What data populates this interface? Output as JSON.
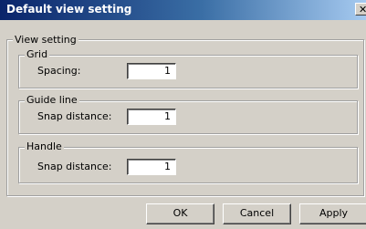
{
  "window": {
    "title": "Default view setting",
    "close_glyph": "✕"
  },
  "view_setting": {
    "label": "View setting",
    "grid": {
      "label": "Grid",
      "field_label": "Spacing:",
      "value": "1"
    },
    "guide_line": {
      "label": "Guide line",
      "field_label": "Snap distance:",
      "value": "1"
    },
    "handle": {
      "label": "Handle",
      "field_label": "Snap distance:",
      "value": "1"
    }
  },
  "buttons": {
    "ok": "OK",
    "cancel": "Cancel",
    "apply": "Apply"
  }
}
